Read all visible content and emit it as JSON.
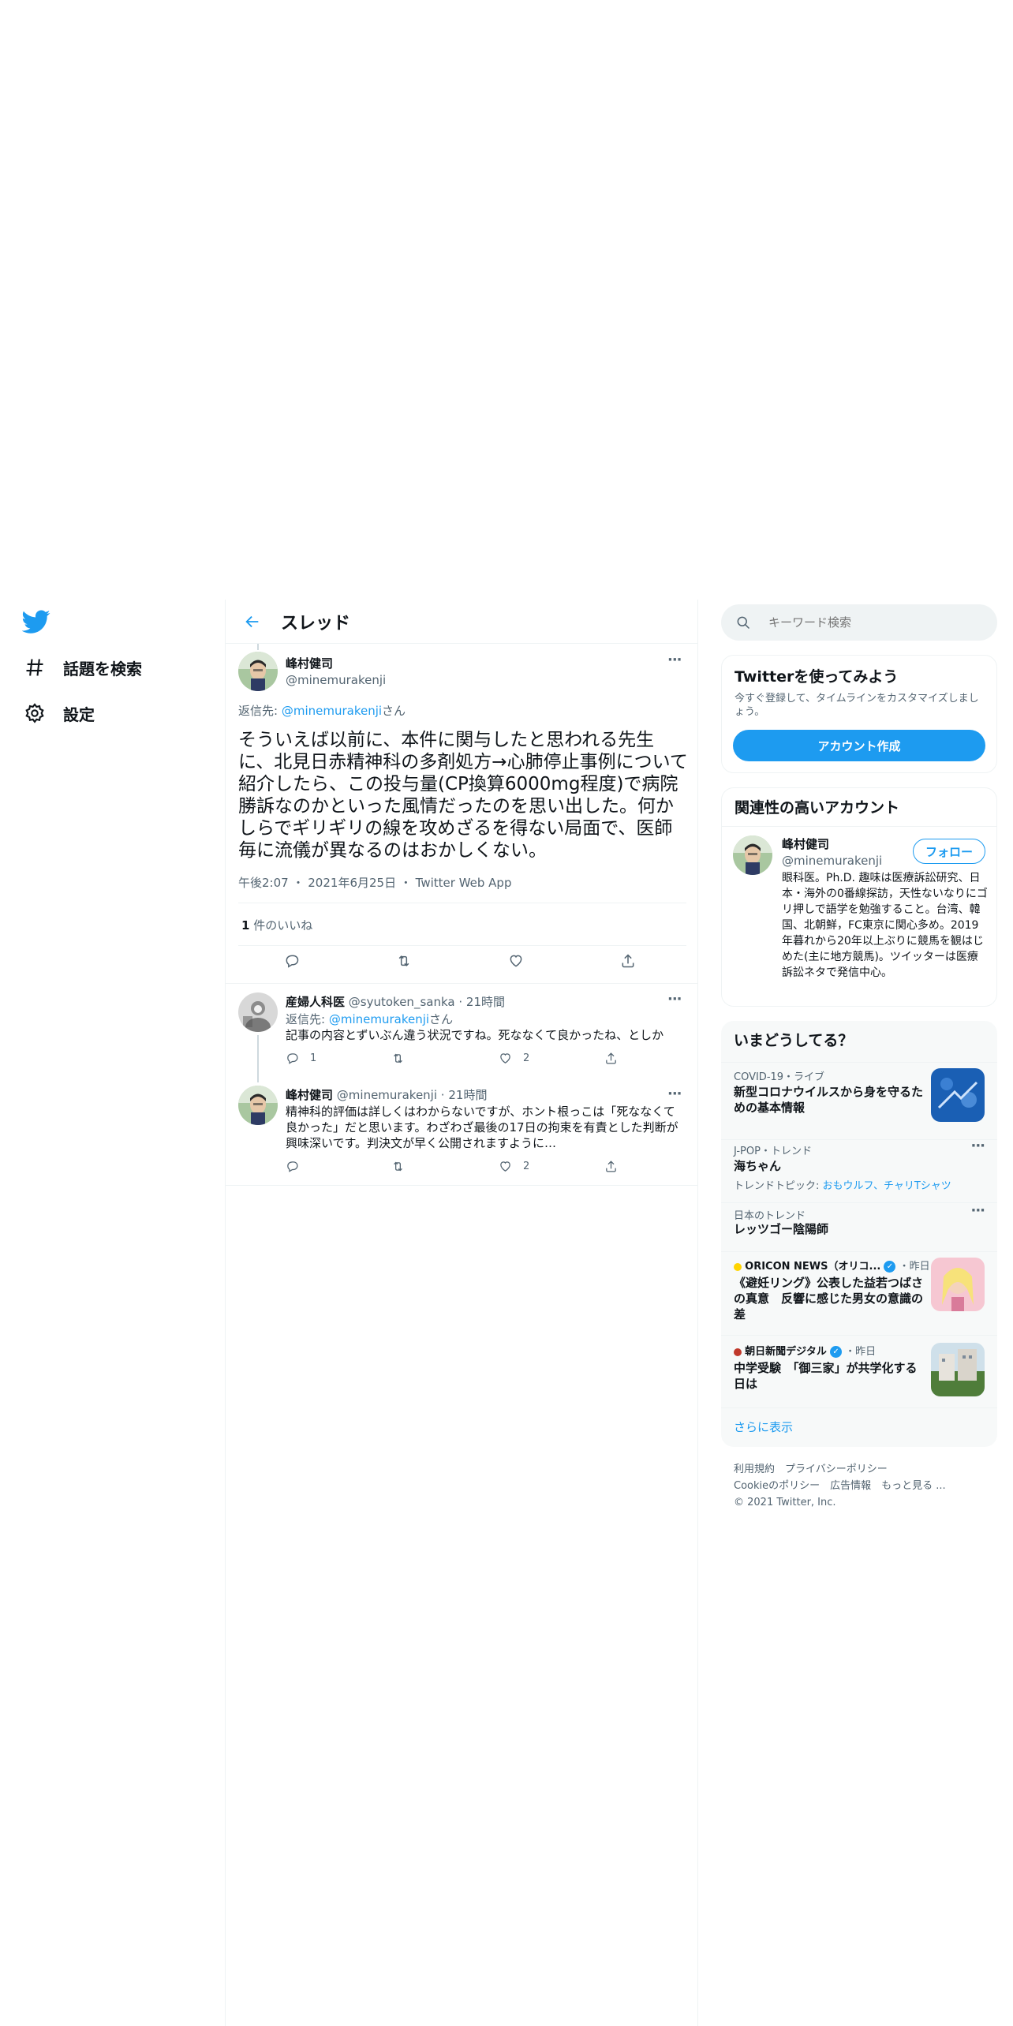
{
  "nav": {
    "items": [
      {
        "label": "話題を検索",
        "icon": "hashtag-icon"
      },
      {
        "label": "設定",
        "icon": "gear-icon"
      }
    ]
  },
  "thread": {
    "title": "スレッド"
  },
  "main_tweet": {
    "name": "峰村健司",
    "handle": "@minemurakenji",
    "reply_prefix": "返信先: ",
    "reply_to": "@minemurakenji",
    "reply_suffix": "さん",
    "text": "そういえば以前に、本件に関与したと思われる先生に、北見日赤精神科の多剤処方→心肺停止事例について紹介したら、この投与量(CP換算6000mg程度)で病院勝訴なのかといった風情だったのを思い出した。何かしらでギリギリの線を攻めざるを得ない局面で、医師毎に流儀が異なるのはおかしくない。",
    "time": "午後2:07",
    "date": "2021年6月25日",
    "source": "Twitter Web App",
    "likes_count": "1",
    "likes_label": " 件のいいね"
  },
  "replies": [
    {
      "name": "産婦人科医",
      "handle": "@syutoken_sanka",
      "time": "21時間",
      "reply_prefix": "返信先: ",
      "reply_to": "@minemurakenji",
      "reply_suffix": "さん",
      "text": "記事の内容とずいぶん違う状況ですね。死ななくて良かったね、としか",
      "reply_count": "1",
      "retweet_count": "",
      "like_count": "2"
    },
    {
      "name": "峰村健司",
      "handle": "@minemurakenji",
      "time": "21時間",
      "text": "精神科的評価は詳しくはわからないですが、ホント根っこは「死ななくて良かった」だと思います。わざわざ最後の17日の拘束を有責とした判断が興味深いです。判決文が早く公開されますように…",
      "reply_count": "",
      "retweet_count": "",
      "like_count": "2"
    }
  ],
  "search": {
    "placeholder": "キーワード検索"
  },
  "signup": {
    "title": "Twitterを使ってみよう",
    "desc": "今すぐ登録して、タイムラインをカスタマイズしましょう。",
    "button": "アカウント作成"
  },
  "related": {
    "title": "関連性の高いアカウント",
    "name": "峰村健司",
    "handle": "@minemurakenji",
    "follow": "フォロー",
    "bio": "眼科医。Ph.D. 趣味は医療訴訟研究、日本・海外の0番線探訪，天性ないなりにゴリ押しで語学を勉強すること。台湾、韓国、北朝鮮，FC東京に関心多め。2019年暮れから20年以上ぶりに競馬を観はじめた(主に地方競馬)。ツイッターは医療訴訟ネタで発信中心。"
  },
  "trends": {
    "title": "いまどうしてる？",
    "items": [
      {
        "meta": "COVID-19・ライブ",
        "title": "新型コロナウイルスから身を守るための基本情報"
      },
      {
        "meta": "J-POP・トレンド",
        "title": "海ちゃん",
        "topics_label": "トレンドトピック: ",
        "topics": "おもウルフ、チャリTシャツ"
      },
      {
        "meta": "日本のトレンド",
        "title": "レッツゴー陰陽師"
      },
      {
        "source": "ORICON NEWS（オリコ...",
        "when": "・昨日",
        "title": "《避妊リング》公表した益若つばさの真意　反響に感じた男女の意識の差"
      },
      {
        "source": "朝日新聞デジタル",
        "when": "・昨日",
        "title": "中学受験　「御三家」が共学化する日は"
      }
    ],
    "more": "さらに表示"
  },
  "footer": {
    "line1": "利用規約　プライバシーポリシー",
    "line2": "Cookieのポリシー　広告情報　もっと見る ...",
    "line3": "© 2021 Twitter, Inc."
  },
  "colors": {
    "accent": "#1d9bf0",
    "text": "#0f1419",
    "muted": "#536471",
    "border": "#eff3f4"
  }
}
